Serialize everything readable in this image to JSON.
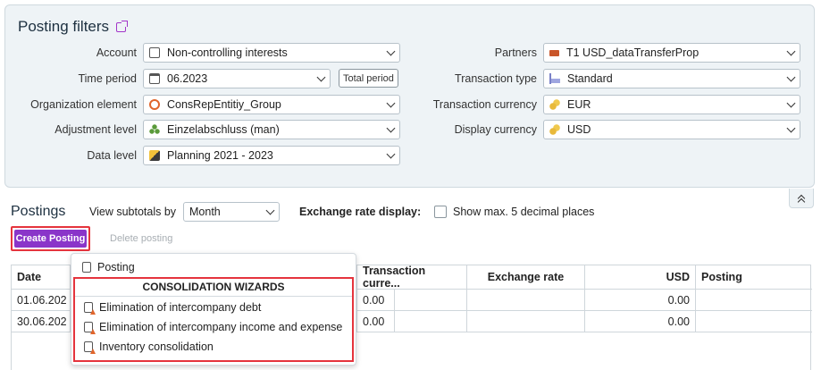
{
  "filters": {
    "title": "Posting filters",
    "account": {
      "label": "Account",
      "value": "Non-controlling interests"
    },
    "time_period": {
      "label": "Time period",
      "value": "06.2023",
      "total_button": "Total period"
    },
    "org_element": {
      "label": "Organization element",
      "value": "ConsRepEntitiy_Group"
    },
    "adjustment_level": {
      "label": "Adjustment level",
      "value": "Einzelabschluss (man)"
    },
    "data_level": {
      "label": "Data level",
      "value": "Planning 2021 - 2023"
    },
    "partners": {
      "label": "Partners",
      "value": "T1 USD_dataTransferProp"
    },
    "transaction_type": {
      "label": "Transaction type",
      "value": "Standard"
    },
    "transaction_currency": {
      "label": "Transaction currency",
      "value": "EUR"
    },
    "display_currency": {
      "label": "Display currency",
      "value": "USD"
    }
  },
  "postings": {
    "title": "Postings",
    "view_subtotals_label": "View subtotals by",
    "view_subtotals_value": "Month",
    "exchange_rate_label": "Exchange rate display:",
    "show_decimals_label": "Show max. 5 decimal places",
    "create_button": "Create Posting",
    "delete_button": "Delete posting"
  },
  "table": {
    "headers": {
      "date": "Date",
      "transaction_currency": "Transaction curre...",
      "exchange_rate": "Exchange rate",
      "usd": "USD",
      "posting": "Posting"
    },
    "rows": [
      {
        "date": "01.06.202",
        "tc": "0.00",
        "usd": "0.00"
      },
      {
        "date": "30.06.202",
        "tc": "0.00",
        "usd": "0.00"
      }
    ]
  },
  "menu": {
    "posting": "Posting",
    "wizards_header": "CONSOLIDATION WIZARDS",
    "wizards": [
      "Elimination of intercompany debt",
      "Elimination of intercompany income and expense",
      "Inventory consolidation"
    ]
  },
  "colors": {
    "accent": "#8a35c9",
    "highlight": "#e5343d",
    "panel": "#eef3f6"
  }
}
